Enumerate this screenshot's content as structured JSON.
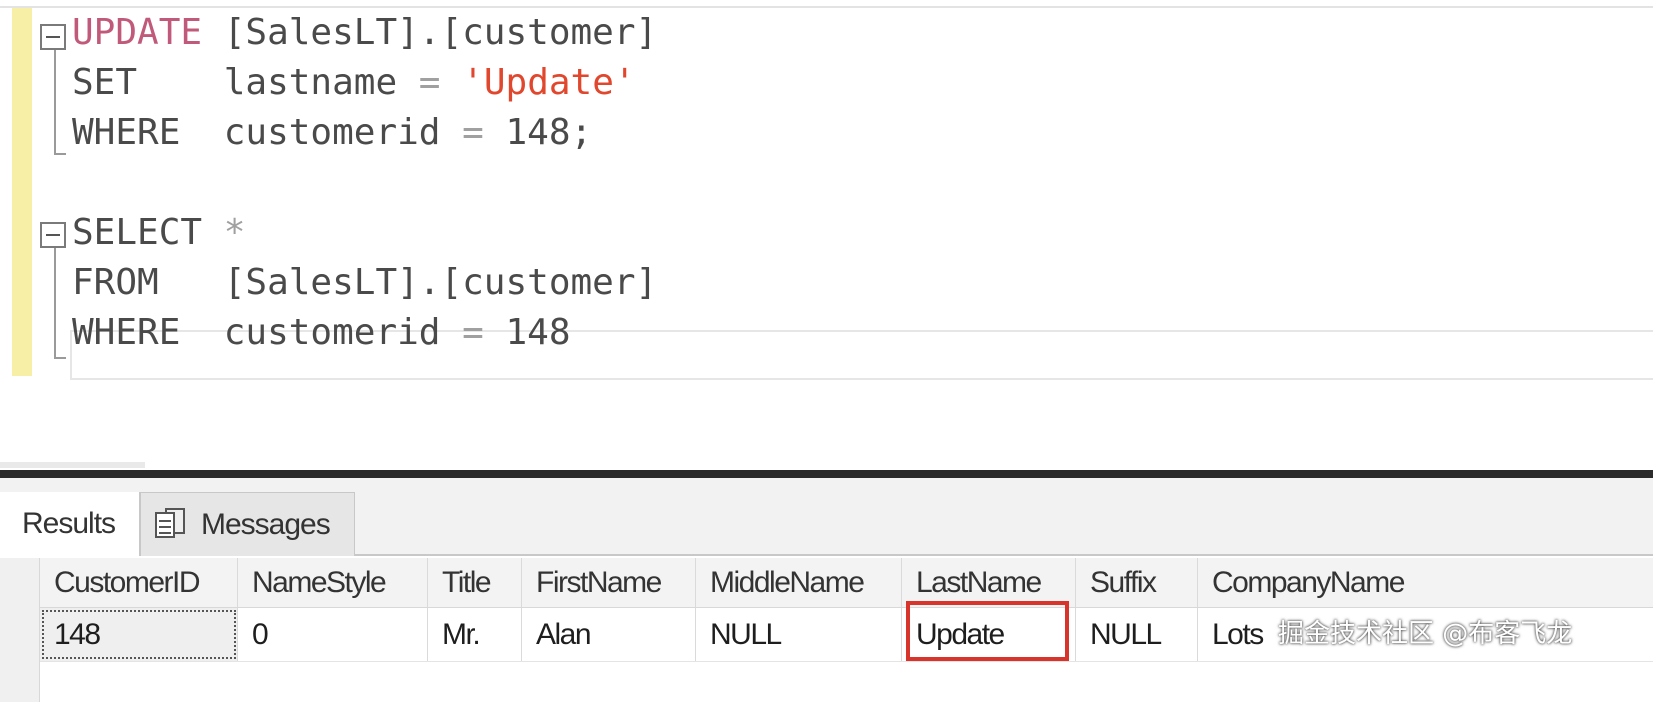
{
  "editor": {
    "lines": [
      {
        "kw": "UPDATE",
        "rest_a": " [SalesLT].[customer]",
        "rest_b": "",
        "rest_c": ""
      },
      {
        "kw": "SET",
        "rest_a": "    lastname ",
        "op": "=",
        "rest_b": " ",
        "str": "'Update'"
      },
      {
        "kw": "WHERE",
        "rest_a": "  customerid ",
        "op": "=",
        "rest_b": " 148;"
      },
      {
        "kw": "SELECT",
        "rest_a": " ",
        "star": "*"
      },
      {
        "kw": "FROM",
        "rest_a": "   [SalesLT].[customer]"
      },
      {
        "kw": "WHERE",
        "rest_a": "  customerid ",
        "op": "=",
        "rest_b": " 148"
      }
    ]
  },
  "results": {
    "tabs": [
      {
        "label": "Results"
      },
      {
        "label": "Messages",
        "icon": "messages-icon"
      }
    ],
    "columns": [
      "CustomerID",
      "NameStyle",
      "Title",
      "FirstName",
      "MiddleName",
      "LastName",
      "Suffix",
      "CompanyName"
    ],
    "rows": [
      [
        "148",
        "0",
        "Mr.",
        "Alan",
        "NULL",
        "Update",
        "NULL",
        "Lots"
      ]
    ],
    "highlight_color": "#d9342b"
  },
  "watermark": "掘金技术社区 @布客飞龙"
}
